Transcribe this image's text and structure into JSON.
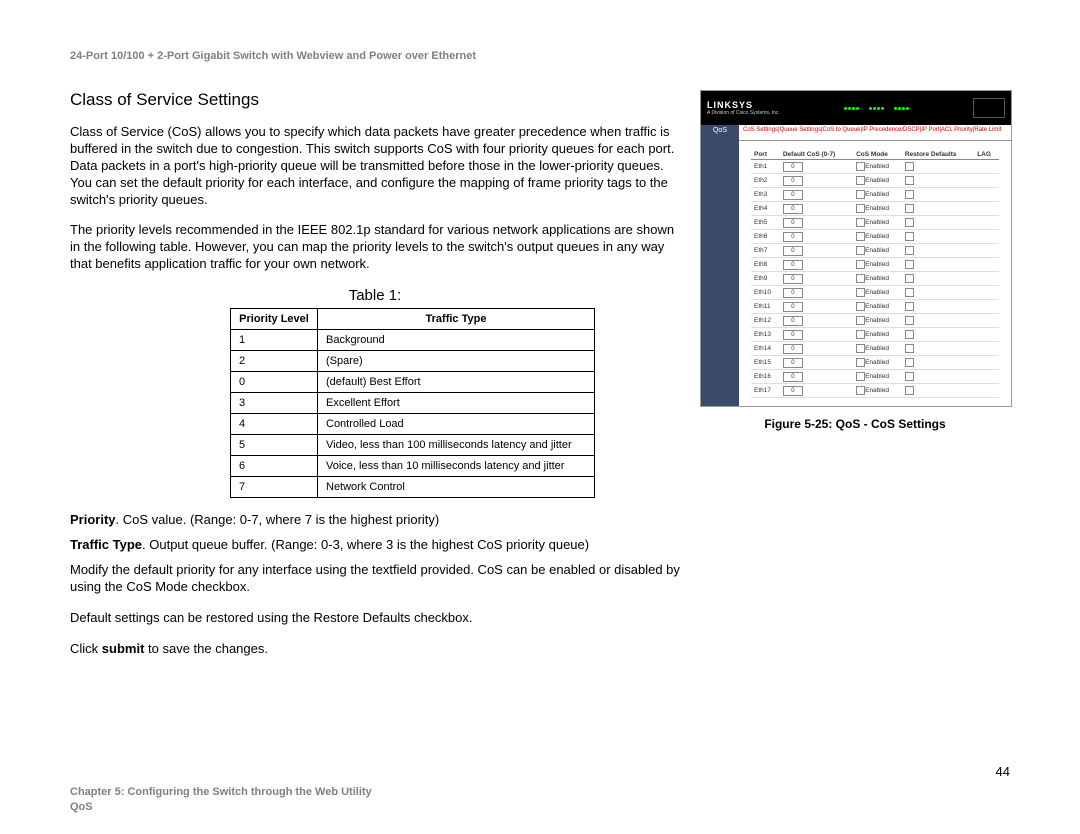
{
  "header": "24-Port 10/100 + 2-Port Gigabit Switch with Webview and Power over Ethernet",
  "section_title": "Class of Service Settings",
  "para1": "Class of Service (CoS) allows you to specify which data packets have greater precedence when traffic is buffered in the switch due to congestion. This switch supports CoS with four priority queues for each port. Data packets in a port's high-priority queue will be transmitted before those in the lower-priority queues. You can set the default priority for each interface, and configure the mapping of frame priority tags to the switch's priority queues.",
  "para2": "The priority levels recommended in the IEEE 802.1p standard for various network applications are shown in the following table. However, you can map the priority levels to the switch's output queues in any way that benefits application traffic for your own network.",
  "table_title": "Table 1:",
  "table_headers": {
    "col1": "Priority Level",
    "col2": "Traffic Type"
  },
  "table_rows": [
    {
      "pl": "1",
      "tt": "Background"
    },
    {
      "pl": "2",
      "tt": "(Spare)"
    },
    {
      "pl": "0",
      "tt": "(default) Best Effort"
    },
    {
      "pl": "3",
      "tt": "Excellent Effort"
    },
    {
      "pl": "4",
      "tt": "Controlled Load"
    },
    {
      "pl": "5",
      "tt": "Video, less than 100 milliseconds latency and jitter"
    },
    {
      "pl": "6",
      "tt": "Voice, less than 10 milliseconds latency and jitter"
    },
    {
      "pl": "7",
      "tt": "Network Control"
    }
  ],
  "def_priority_label": "Priority",
  "def_priority_text": ". CoS value. (Range: 0-7, where 7 is the highest priority)",
  "def_traffic_label": "Traffic Type",
  "def_traffic_text": ". Output queue buffer. (Range: 0-3, where 3 is the highest CoS priority queue)",
  "para3": "Modify the default priority for any interface using the textfield provided. CoS can be enabled or disabled by using the CoS Mode checkbox.",
  "para4": "Default settings can be restored using the Restore Defaults checkbox.",
  "para5_pre": "Click ",
  "para5_bold": "submit",
  "para5_post": " to save the changes.",
  "figure_caption": "Figure 5-25: QoS - CoS Settings",
  "page_num": "44",
  "footer_line1": "Chapter 5: Configuring the Switch through the Web Utility",
  "footer_line2": "QoS",
  "screenshot": {
    "logo": "LINKSYS",
    "sidebar_label": "QoS",
    "breadcrumb": "CoS Settings|Queue Settings|CoS to Queue|IP Precedence/DSCP|IP Port|ACL Priority|Rate Limit",
    "th": {
      "port": "Port",
      "cos": "Default CoS (0-7)",
      "mode": "CoS Mode",
      "restore": "Restore Defaults",
      "lag": "LAG"
    },
    "enabled": "Enabled",
    "rows": [
      {
        "port": "Eth1",
        "cos": "0"
      },
      {
        "port": "Eth2",
        "cos": "0"
      },
      {
        "port": "Eth3",
        "cos": "0"
      },
      {
        "port": "Eth4",
        "cos": "0"
      },
      {
        "port": "Eth5",
        "cos": "0"
      },
      {
        "port": "Eth6",
        "cos": "0"
      },
      {
        "port": "Eth7",
        "cos": "0"
      },
      {
        "port": "Eth8",
        "cos": "0"
      },
      {
        "port": "Eth9",
        "cos": "0"
      },
      {
        "port": "Eth10",
        "cos": "0"
      },
      {
        "port": "Eth11",
        "cos": "0"
      },
      {
        "port": "Eth12",
        "cos": "0"
      },
      {
        "port": "Eth13",
        "cos": "0"
      },
      {
        "port": "Eth14",
        "cos": "0"
      },
      {
        "port": "Eth15",
        "cos": "0"
      },
      {
        "port": "Eth16",
        "cos": "0"
      },
      {
        "port": "Eth17",
        "cos": "0"
      }
    ]
  }
}
